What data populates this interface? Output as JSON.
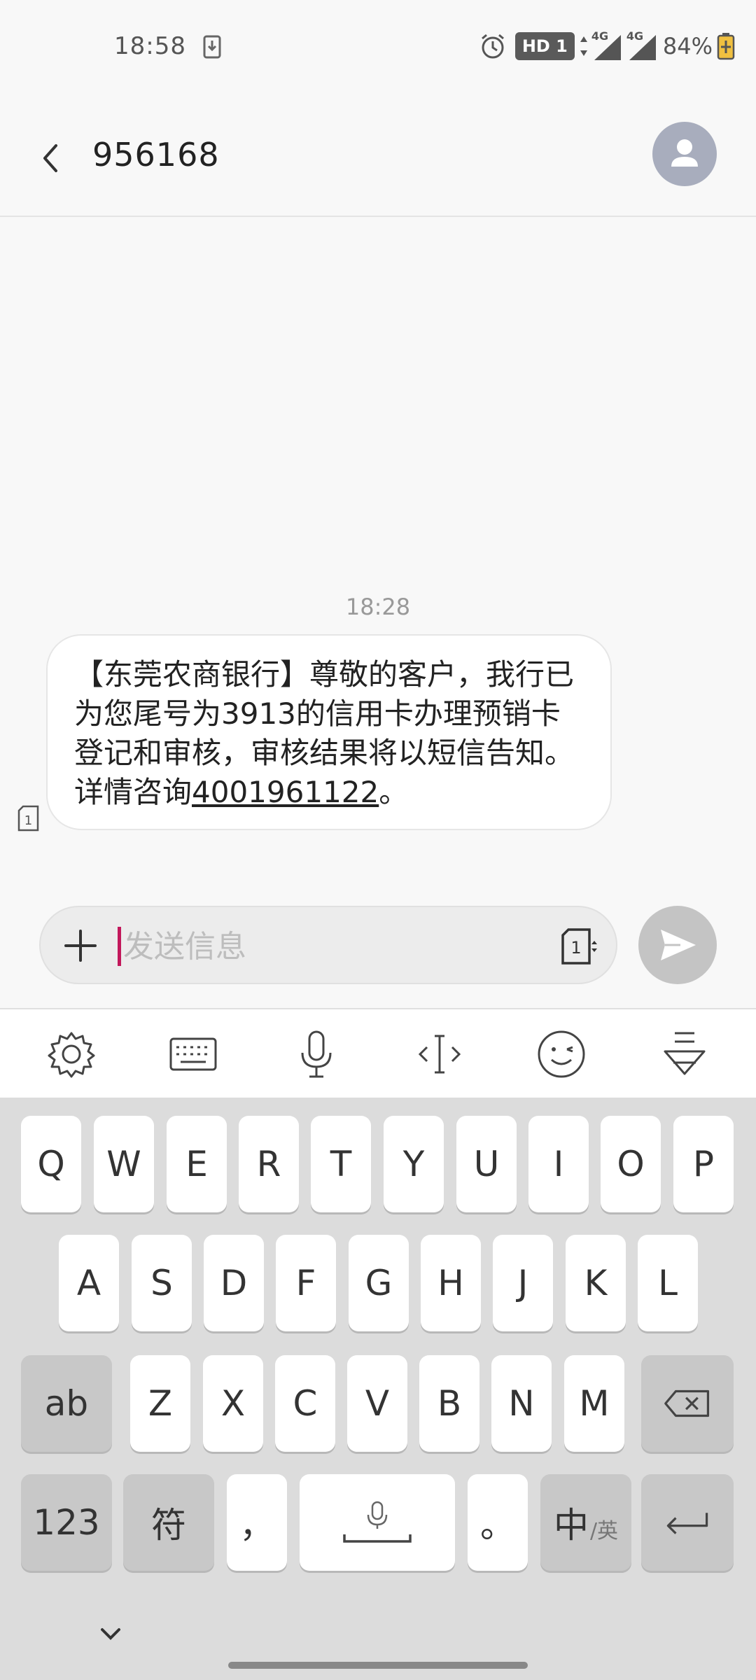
{
  "status_bar": {
    "time": "18:58",
    "hd_badge": "HD 1",
    "network_1": "4G",
    "network_2": "4G",
    "battery": "84%"
  },
  "header": {
    "contact": "956168"
  },
  "conversation": {
    "timestamp": "18:28",
    "message_prefix": "【东莞农商银行】尊敬的客户，我行已为您尾号为3913的信用卡办理预销卡登记和审核，审核结果将以短信告知。详情咨询",
    "message_phone": "4001961122",
    "message_suffix": "。",
    "sim_label": "1"
  },
  "composer": {
    "placeholder": "发送信息",
    "sim_label": "1"
  },
  "keyboard": {
    "row1": [
      "Q",
      "W",
      "E",
      "R",
      "T",
      "Y",
      "U",
      "I",
      "O",
      "P"
    ],
    "row2": [
      "A",
      "S",
      "D",
      "F",
      "G",
      "H",
      "J",
      "K",
      "L"
    ],
    "row3": [
      "Z",
      "X",
      "C",
      "V",
      "B",
      "N",
      "M"
    ],
    "shift_label": "ab",
    "numbers_label": "123",
    "symbols_label": "符",
    "comma_label": "，",
    "period_label": "。",
    "lang_main": "中",
    "lang_sub": "/英"
  },
  "colors": {
    "accent_caret": "#c2185b",
    "avatar_bg": "#a8adbd",
    "send_disabled": "#c4c4c4"
  }
}
